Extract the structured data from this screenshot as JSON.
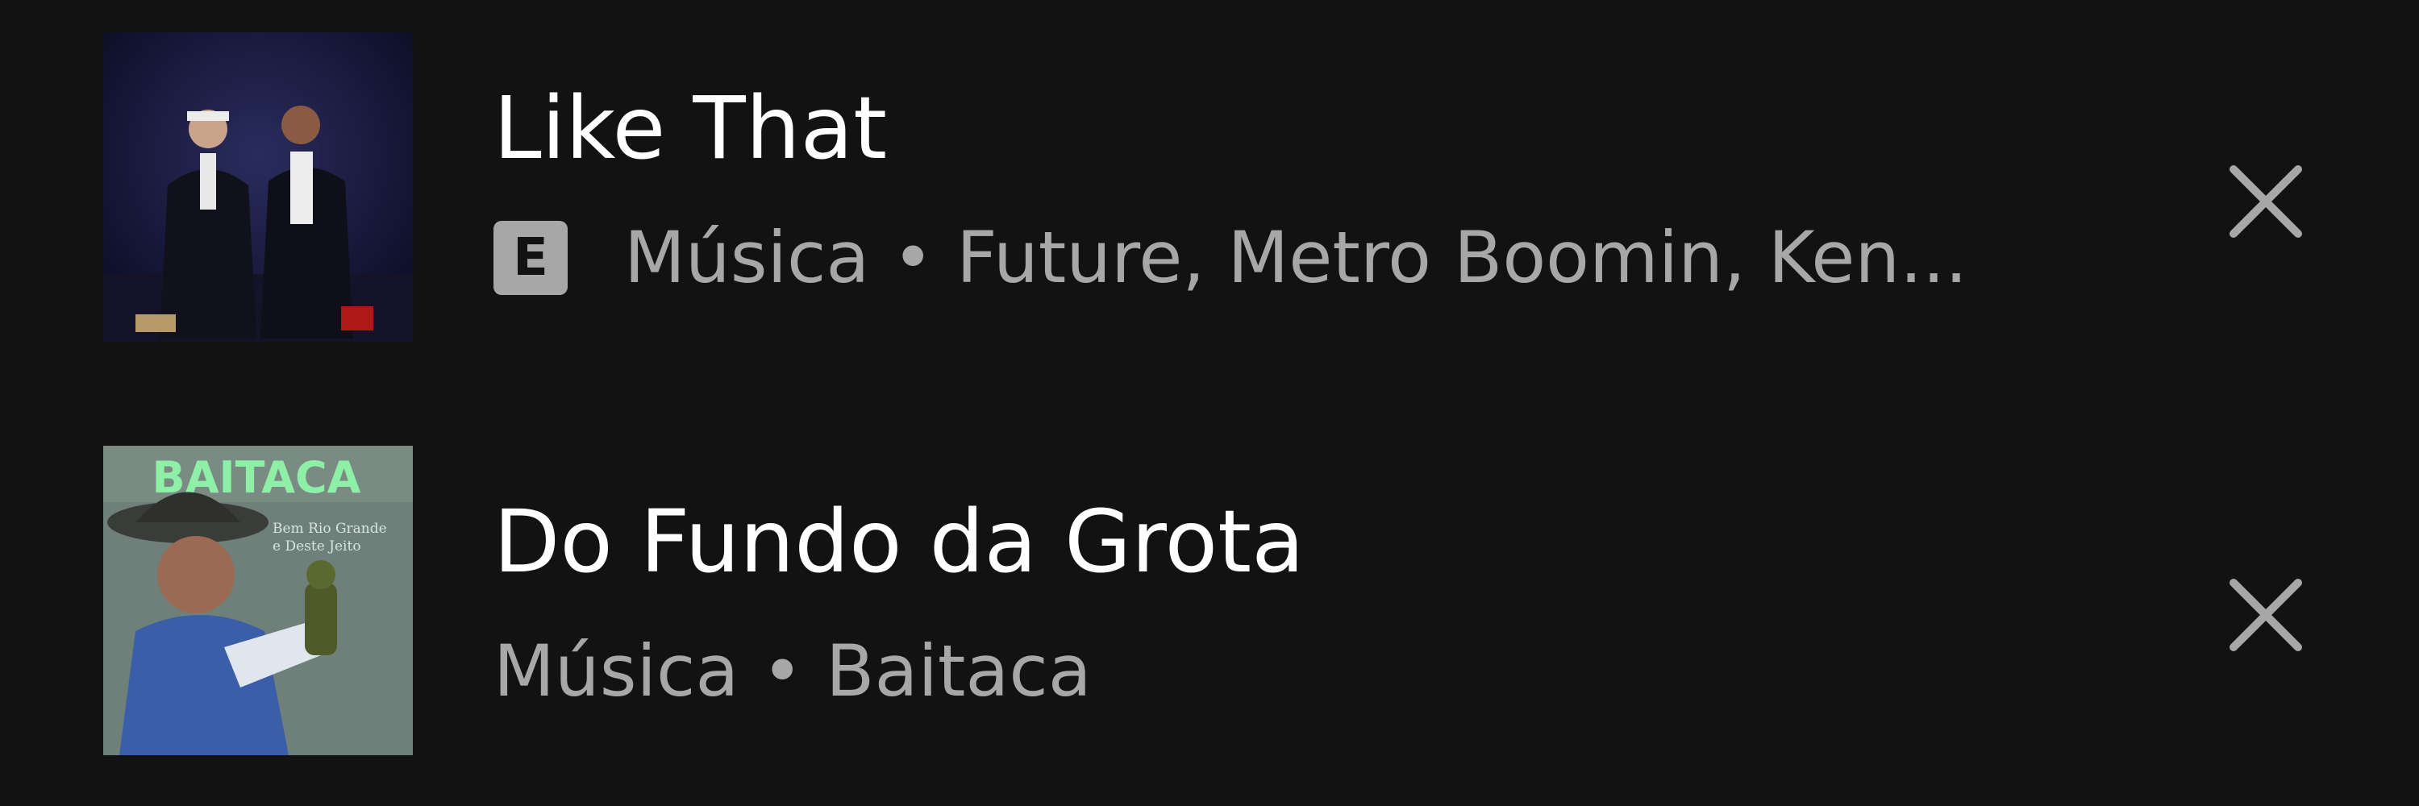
{
  "recent_searches": [
    {
      "title": "Like That",
      "explicit_badge": "E",
      "subtitle": "Música • Future, Metro Boomin, Ken...",
      "cover_icon": "album-cover-like-that",
      "remove_icon": "close-icon"
    },
    {
      "title": "Do Fundo da Grota",
      "subtitle": "Música • Baitaca",
      "cover_icon": "album-cover-baitaca",
      "cover_text": "BAITACA",
      "cover_subtext_line1": "Bem Rio Grande",
      "cover_subtext_line2": "e Deste Jeito",
      "remove_icon": "close-icon"
    }
  ],
  "colors": {
    "background": "#121212",
    "title": "#ffffff",
    "subtitle": "#a7a7a7",
    "badge": "#a7a7a7"
  }
}
